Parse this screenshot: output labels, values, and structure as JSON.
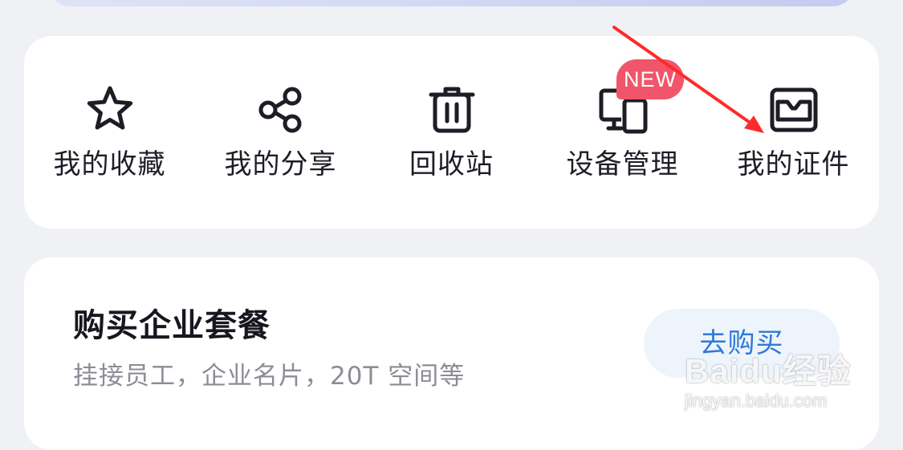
{
  "quick_actions": [
    {
      "label": "我的收藏",
      "icon": "star-icon"
    },
    {
      "label": "我的分享",
      "icon": "share-icon"
    },
    {
      "label": "回收站",
      "icon": "trash-icon"
    },
    {
      "label": "设备管理",
      "icon": "devices-icon"
    },
    {
      "label": "我的证件",
      "icon": "id-card-icon"
    }
  ],
  "badges": {
    "new": "NEW"
  },
  "promo": {
    "title": "购买企业套餐",
    "subtitle": "挂接员工，企业名片，20T 空间等",
    "button_label": "去购买"
  },
  "watermark": {
    "logo": "Baidu经验",
    "url": "jingyan.baidu.com"
  },
  "colors": {
    "page_background": "#f0f1f5",
    "card_background": "#ffffff",
    "icon_stroke": "#1d1d26",
    "new_badge": "#f0556b",
    "button_text": "#2f79d6",
    "button_background": "#eef4fc",
    "annotation_arrow": "#ff2a2a"
  }
}
